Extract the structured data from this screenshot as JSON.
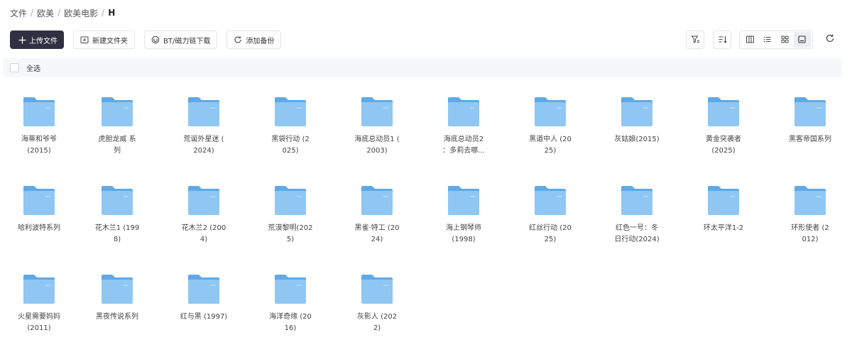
{
  "breadcrumb": [
    "文件",
    "欧美",
    "欧美电影",
    "H"
  ],
  "toolbar": {
    "upload_label": "上传文件",
    "new_folder_label": "新建文件夹",
    "bt_label": "BT/磁力链下载",
    "backup_label": "添加备份"
  },
  "selection": {
    "select_all_label": "全选"
  },
  "colors": {
    "primary_button": "#2f3142",
    "folder_light": "#8fc7f2",
    "folder_dark": "#5fa9e6",
    "select_bar": "#f6f7f9"
  },
  "folders": [
    {
      "name": "海蒂和爷爷\n(2015)"
    },
    {
      "name": "虎胆龙威 系\n列"
    },
    {
      "name": "荒诞外星迷 (\n2024)"
    },
    {
      "name": "黑袋行动 (2\n025)"
    },
    {
      "name": "海底总动员1 (\n2003)"
    },
    {
      "name": "海底总动员2\n：多莉去哪..."
    },
    {
      "name": "黑道中人 (20\n25)"
    },
    {
      "name": "灰姑娘(2015)"
    },
    {
      "name": "黄金突袭者\n(2025)"
    },
    {
      "name": "黑客帝国系列"
    },
    {
      "name": "哈利波特系列"
    },
    {
      "name": "花木兰1 (199\n8)"
    },
    {
      "name": "花木兰2 (200\n4)"
    },
    {
      "name": "荒漠黎明(202\n5)"
    },
    {
      "name": "黑雀·特工 (20\n24)"
    },
    {
      "name": "海上钢琴师\n(1998)"
    },
    {
      "name": "红丝行动 (20\n25)"
    },
    {
      "name": "红色一号：冬\n日行动(2024)"
    },
    {
      "name": "环太平洋1-2"
    },
    {
      "name": "环形使者 (2\n012)"
    },
    {
      "name": "火星需要妈妈\n(2011)"
    },
    {
      "name": "黑夜传说系列"
    },
    {
      "name": "红与黑 (1997)"
    },
    {
      "name": "海洋奇缘 (20\n16)"
    },
    {
      "name": "灰影人 (202\n2)"
    }
  ]
}
